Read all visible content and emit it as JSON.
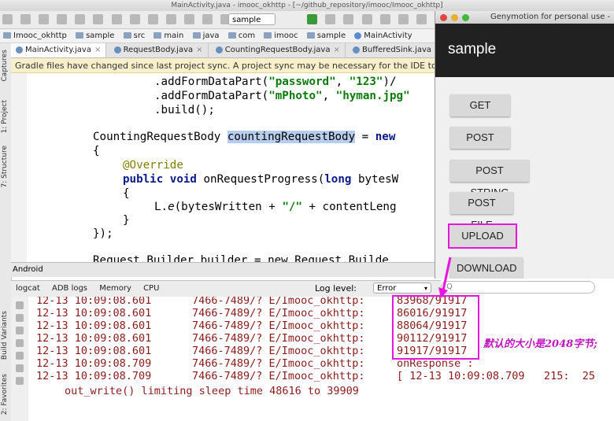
{
  "ide": {
    "window_title": "MainActivity.java - imooc_okhttp - [~/github_repository/imooc/Imooc_okhttp]",
    "run_config": "sample",
    "breadcrumbs": [
      "Imooc_okhttp",
      "sample",
      "src",
      "main",
      "java",
      "com",
      "imooc",
      "sample",
      "MainActivity"
    ],
    "tabs": [
      "MainActivity.java",
      "RequestBody.java",
      "CountingRequestBody.java",
      "BufferedSink.java"
    ],
    "sidebar_labels": [
      "1: Project",
      "7: Structure",
      "Captures",
      "Build Variants",
      "2: Favorites"
    ],
    "notice": "Gradle files have changed since last project sync. A project sync may be necessary for the IDE to",
    "lower_label": "Android",
    "code": {
      "l1_pre": ".addFormDataPart(",
      "l1_s1": "\"password\"",
      "l1_mid": ", ",
      "l1_s2": "\"123\"",
      "l1_post": ")/",
      "l2_pre": ".addFormDataPart(",
      "l2_s1": "\"mPhoto\"",
      "l2_mid": ", ",
      "l2_s2": "\"hyman.jpg\"",
      "l3": ".build();",
      "l4_type": "CountingRequestBody ",
      "l4_var": "countingRequestBody",
      "l4_eq": " = ",
      "l4_new": "new",
      "l5": "{",
      "l6": "@Override",
      "l7_kw1": "public void ",
      "l7_name": "onRequestProgress(",
      "l7_kw2": "long ",
      "l7_arg": "bytesW",
      "l8": "{",
      "l9_cls": "L.",
      "l9_m": "e",
      "l9_a": "(bytesWritten + ",
      "l9_s": "\"/\"",
      "l9_b": " + contentLeng",
      "l10": "}",
      "l11": "});",
      "l12": "Request.Builder builder = new Request.Builde"
    },
    "log_tabs": [
      "logcat",
      "ADB logs",
      "Memory",
      "CPU"
    ],
    "log_level_label": "Log level:",
    "log_level_value": "Error",
    "log_rows": [
      {
        "time": "12-13 10:09:08.601",
        "pid": "7466-7489/? E/Imooc_okhttp:",
        "val": "83968/91917"
      },
      {
        "time": "12-13 10:09:08.601",
        "pid": "7466-7489/? E/Imooc_okhttp:",
        "val": "86016/91917"
      },
      {
        "time": "12-13 10:09:08.601",
        "pid": "7466-7489/? E/Imooc_okhttp:",
        "val": "88064/91917"
      },
      {
        "time": "12-13 10:09:08.601",
        "pid": "7466-7489/? E/Imooc_okhttp:",
        "val": "90112/91917"
      },
      {
        "time": "12-13 10:09:08.601",
        "pid": "7466-7489/? E/Imooc_okhttp:",
        "val": "91917/91917"
      },
      {
        "time": "12-13 10:09:08.709",
        "pid": "7466-7489/? E/Imooc_okhttp:",
        "val": "onResponse :"
      },
      {
        "time": "12-13 10:09:08.709",
        "pid": "7466-7489/? E/Imooc_okhttp:",
        "val": "[ 12-13 10:09:08.709   215:  25"
      }
    ],
    "log_last": "out_write() limiting sleep time 48616 to 39909",
    "annotation": "默认的大小是2048字节;"
  },
  "emulator": {
    "title": "Genymotion for personal use -",
    "app_title": "sample",
    "buttons": [
      "GET",
      "POST",
      "POST STRING",
      "POST FILE",
      "UPLOAD",
      "DOWNLOAD"
    ],
    "search_placeholder": "Q"
  },
  "colors": {
    "highlight": "#e815e0",
    "log_text": "#8b1a1a",
    "string": "#0b7a0b",
    "keyword": "#0a1a8a"
  }
}
